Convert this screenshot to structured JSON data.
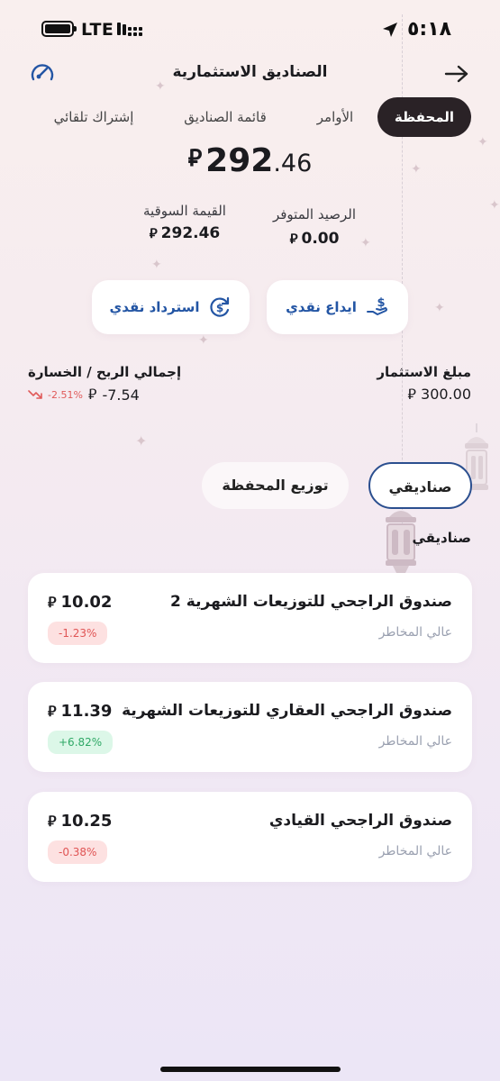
{
  "status_bar": {
    "network": "LTE",
    "time": "٥:١٨"
  },
  "header": {
    "title": "الصناديق الاستثمارية"
  },
  "tabs": [
    {
      "label": "المحفظة",
      "active": true
    },
    {
      "label": "الأوامر",
      "active": false
    },
    {
      "label": "قائمة الصناديق",
      "active": false
    },
    {
      "label": "إشتراك تلقائي",
      "active": false
    }
  ],
  "balance": {
    "currency_symbol": "⃁",
    "integer": "292",
    "decimal": ".46"
  },
  "summary": {
    "available_label": "الرصيد المتوفر",
    "available_value": "0.00",
    "market_label": "القيمة السوقية",
    "market_value": "292.46"
  },
  "actions": {
    "deposit_label": "ايداع نقدي",
    "redeem_label": "استرداد نقدي"
  },
  "investment": {
    "label": "مبلغ الاستثمار",
    "value": "300.00"
  },
  "profit_loss": {
    "label": "إجمالي الربح / الخسارة",
    "value": "-7.54",
    "percent": "-2.51%"
  },
  "segments": {
    "my_funds": "صناديقي",
    "distribution": "توزيع المحفظة"
  },
  "section_title": "صناديقي",
  "funds": [
    {
      "name": "صندوق الراجحي للتوزيعات الشهرية 2",
      "risk": "عالي المخاطر",
      "price": "10.02",
      "change": "-1.23%",
      "trend": "neg"
    },
    {
      "name": "صندوق الراجحي العقاري للتوزيعات الشهرية",
      "risk": "عالي المخاطر",
      "price": "11.39",
      "change": "+6.82%",
      "trend": "pos"
    },
    {
      "name": "صندوق الراجحي القيادي",
      "risk": "عالي المخاطر",
      "price": "10.25",
      "change": "-0.38%",
      "trend": "neg"
    }
  ],
  "colors": {
    "accent": "#2355a4",
    "active_tab": "#2a2226",
    "negative": "#e05555",
    "positive": "#2fa866"
  }
}
